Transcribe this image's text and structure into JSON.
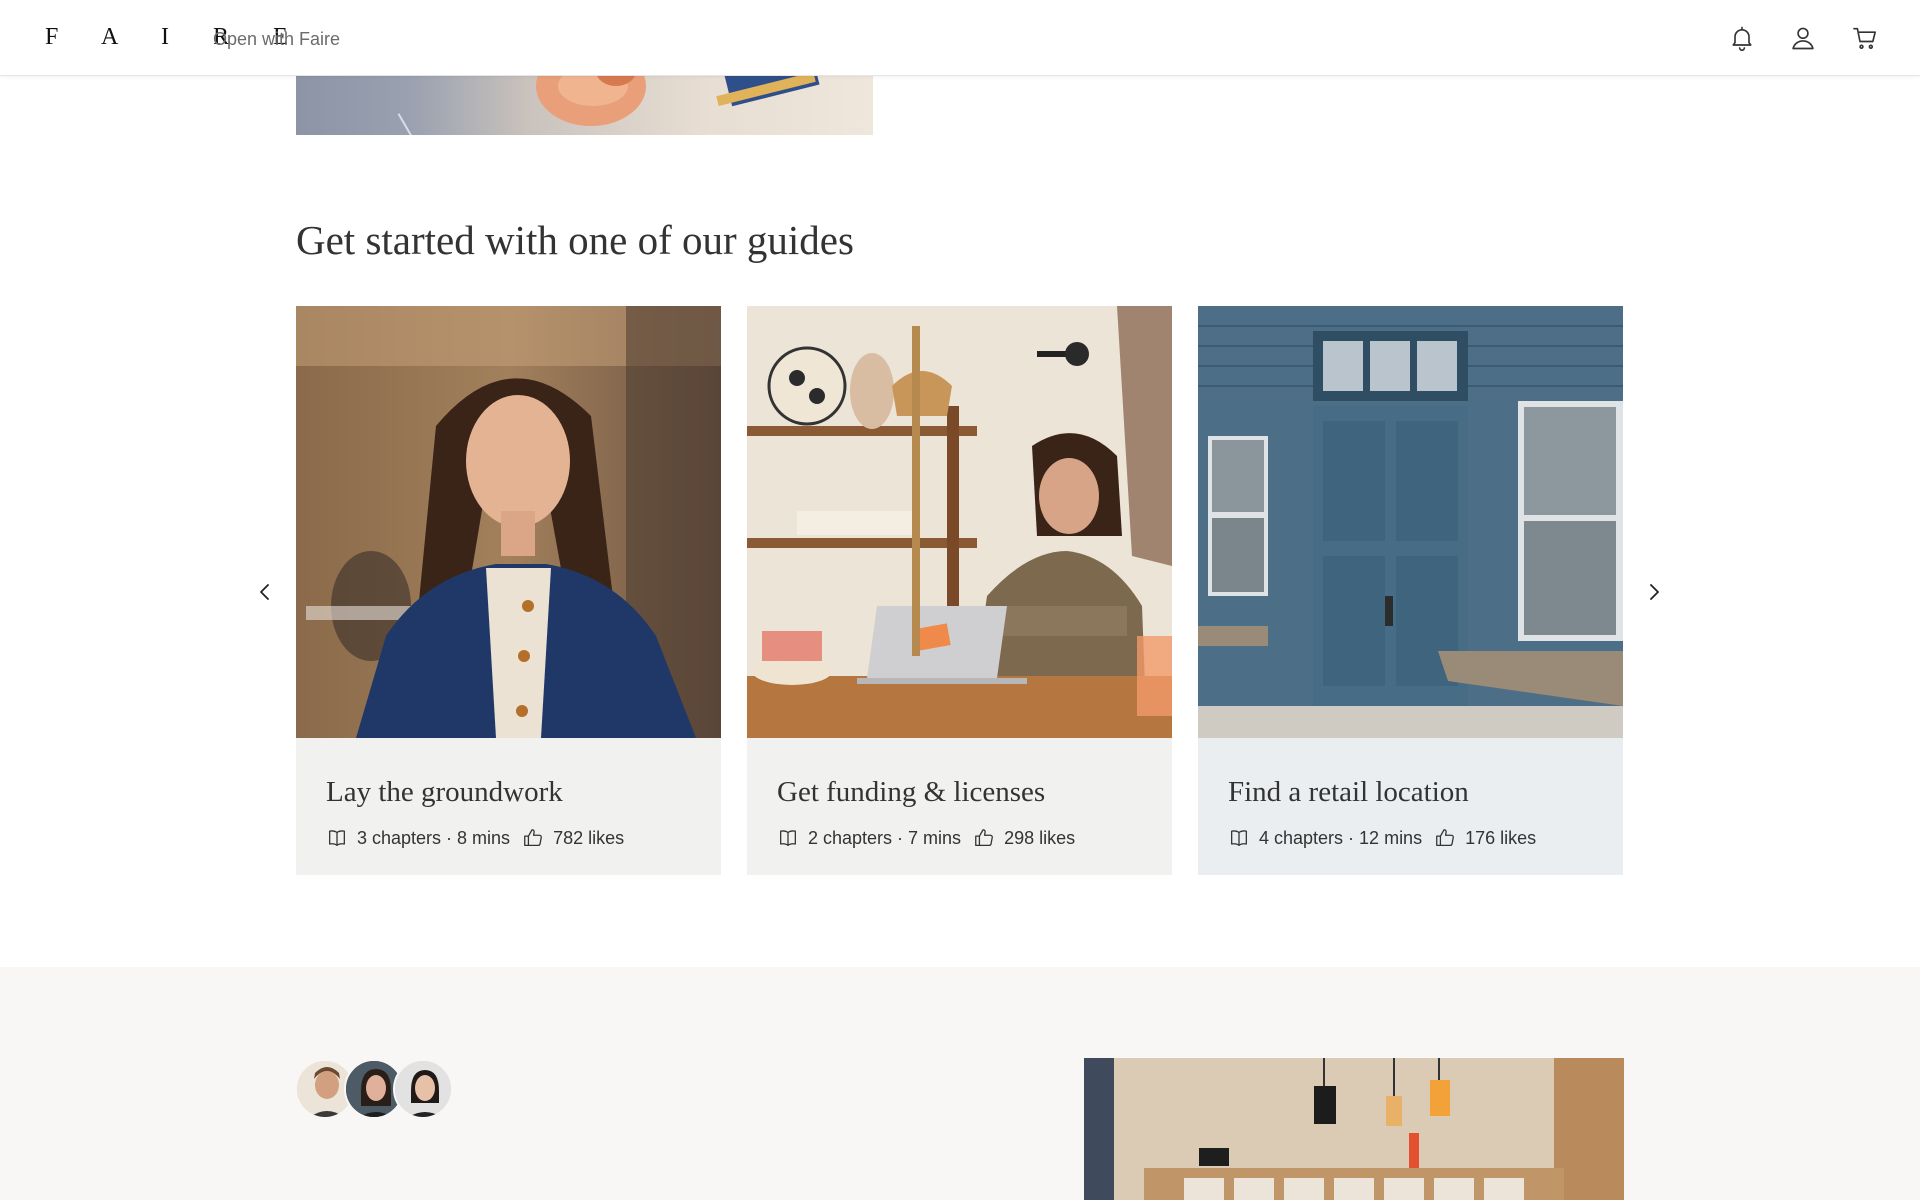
{
  "header": {
    "logo": "F A I R E",
    "open_link": "Open with Faire",
    "icons": [
      "bell-icon",
      "user-icon",
      "cart-icon"
    ]
  },
  "guides": {
    "title": "Get started with one of our guides",
    "cards": [
      {
        "title": "Lay the groundwork",
        "chapters_time": "3 chapters · 8 mins",
        "likes": "782 likes",
        "image": "woman-in-denim-jacket-photo"
      },
      {
        "title": "Get funding & licenses",
        "chapters_time": "2 chapters · 7 mins",
        "likes": "298 likes",
        "image": "woman-at-laptop-in-shop-photo"
      },
      {
        "title": "Find a retail location",
        "chapters_time": "4 chapters · 12 mins",
        "likes": "176 likes",
        "image": "blue-storefront-door-photo"
      }
    ]
  },
  "colors": {
    "text": "#333333",
    "muted": "#6b6b6b",
    "card_bg": "#f1f1ef",
    "section_bg": "#f8f7f5"
  }
}
